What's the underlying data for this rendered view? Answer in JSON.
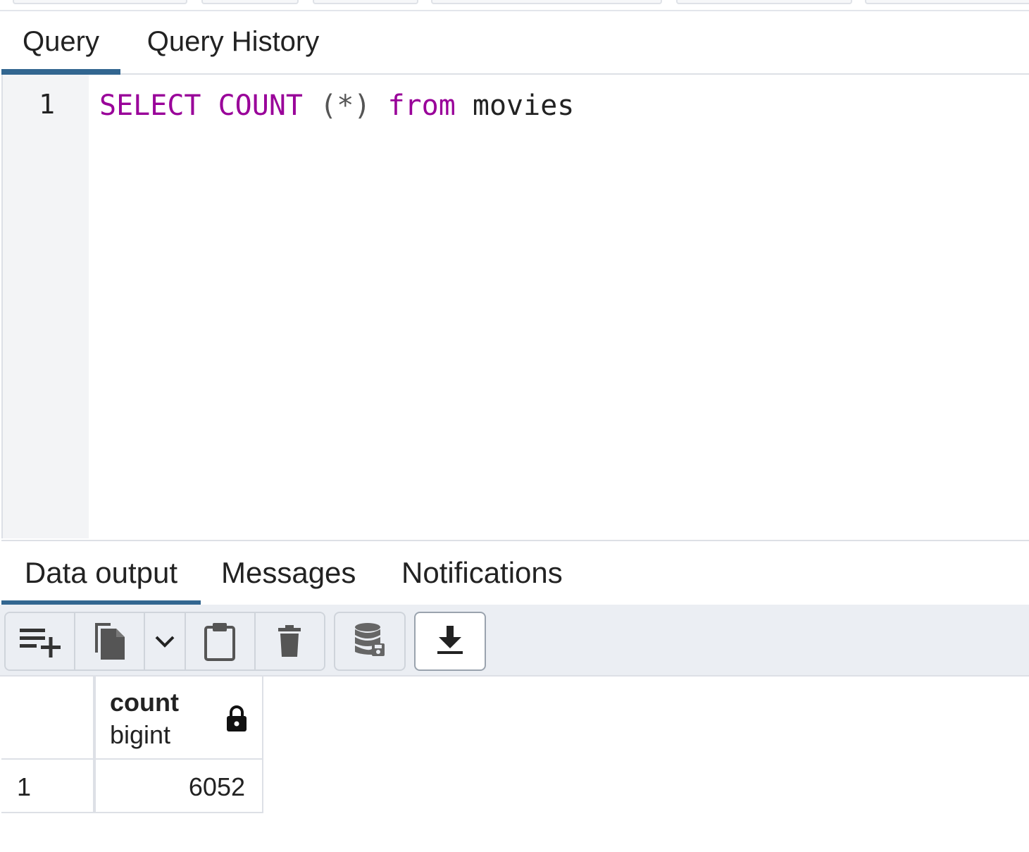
{
  "query_tabs": [
    {
      "label": "Query",
      "active": true
    },
    {
      "label": "Query History",
      "active": false
    }
  ],
  "editor": {
    "line_number": "1",
    "tokens": {
      "select": "SELECT",
      "count": "COUNT",
      "paren": "(*)",
      "from": "from",
      "table": "movies"
    }
  },
  "result_tabs": [
    {
      "label": "Data output",
      "active": true
    },
    {
      "label": "Messages",
      "active": false
    },
    {
      "label": "Notifications",
      "active": false
    }
  ],
  "toolbar": {
    "icons": [
      "add-row-icon",
      "copy-icon",
      "chevron-down-icon",
      "paste-icon",
      "delete-icon",
      "save-data-icon",
      "download-icon"
    ]
  },
  "result_grid": {
    "columns": [
      {
        "name": "count",
        "type": "bigint",
        "locked": true
      }
    ],
    "rows": [
      {
        "row_number": "1",
        "values": [
          "6052"
        ]
      }
    ]
  },
  "colors": {
    "accent": "#326690",
    "keyword": "#990099",
    "toolbar_bg": "#ebeef3",
    "gutter_bg": "#f3f4f6"
  }
}
